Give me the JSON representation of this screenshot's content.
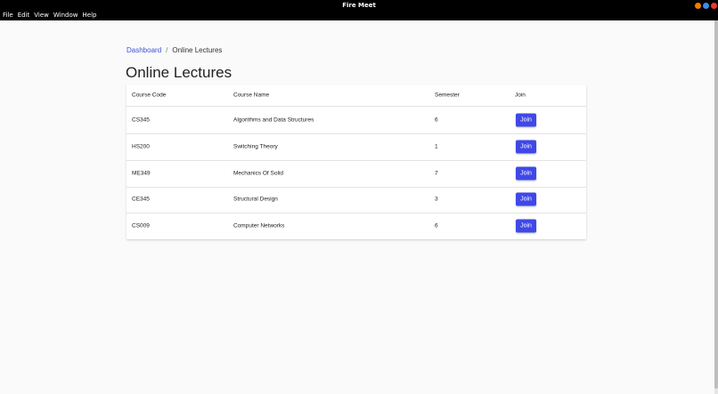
{
  "window": {
    "title": "Fire Meet",
    "controls": [
      {
        "name": "minimize",
        "color": "#f57c00"
      },
      {
        "name": "maximize",
        "color": "#3d8de6"
      },
      {
        "name": "close",
        "color": "#e53935"
      }
    ]
  },
  "menu": [
    "File",
    "Edit",
    "View",
    "Window",
    "Help"
  ],
  "breadcrumb": {
    "link": "Dashboard",
    "separator": "/",
    "current": "Online Lectures"
  },
  "page_title": "Online Lectures",
  "table": {
    "headers": {
      "code": "Course Code",
      "name": "Course Name",
      "semester": "Semester",
      "join": "Join"
    },
    "join_label": "Join",
    "rows": [
      {
        "code": "CS345",
        "name": "Algorithms and Data Structures",
        "semester": "6"
      },
      {
        "code": "HS200",
        "name": "Switching Theory",
        "semester": "1"
      },
      {
        "code": "ME349",
        "name": "Mechanics Of Solid",
        "semester": "7"
      },
      {
        "code": "CE345",
        "name": "Structural Design",
        "semester": "3"
      },
      {
        "code": "CS009",
        "name": "Computer Networks",
        "semester": "6"
      }
    ]
  },
  "colors": {
    "accent": "#3f48e6",
    "link": "#3f51d8"
  }
}
